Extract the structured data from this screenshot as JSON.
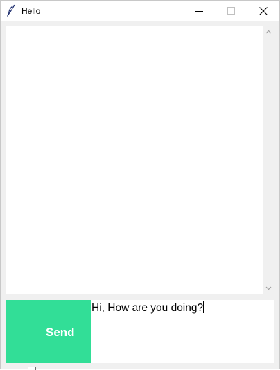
{
  "window": {
    "title": "Hello",
    "icon": "feather-icon",
    "controls": {
      "minimize_icon": "minimize-icon",
      "maximize_icon": "maximize-icon",
      "close_icon": "close-icon"
    }
  },
  "chat": {
    "messages": []
  },
  "composer": {
    "send_label": "Send",
    "input_value": "Hi, How are you doing?"
  },
  "colors": {
    "send_button": "#32de97",
    "send_text": "#ffffff",
    "window_bg": "#f0f0f0",
    "panel_bg": "#ffffff"
  }
}
